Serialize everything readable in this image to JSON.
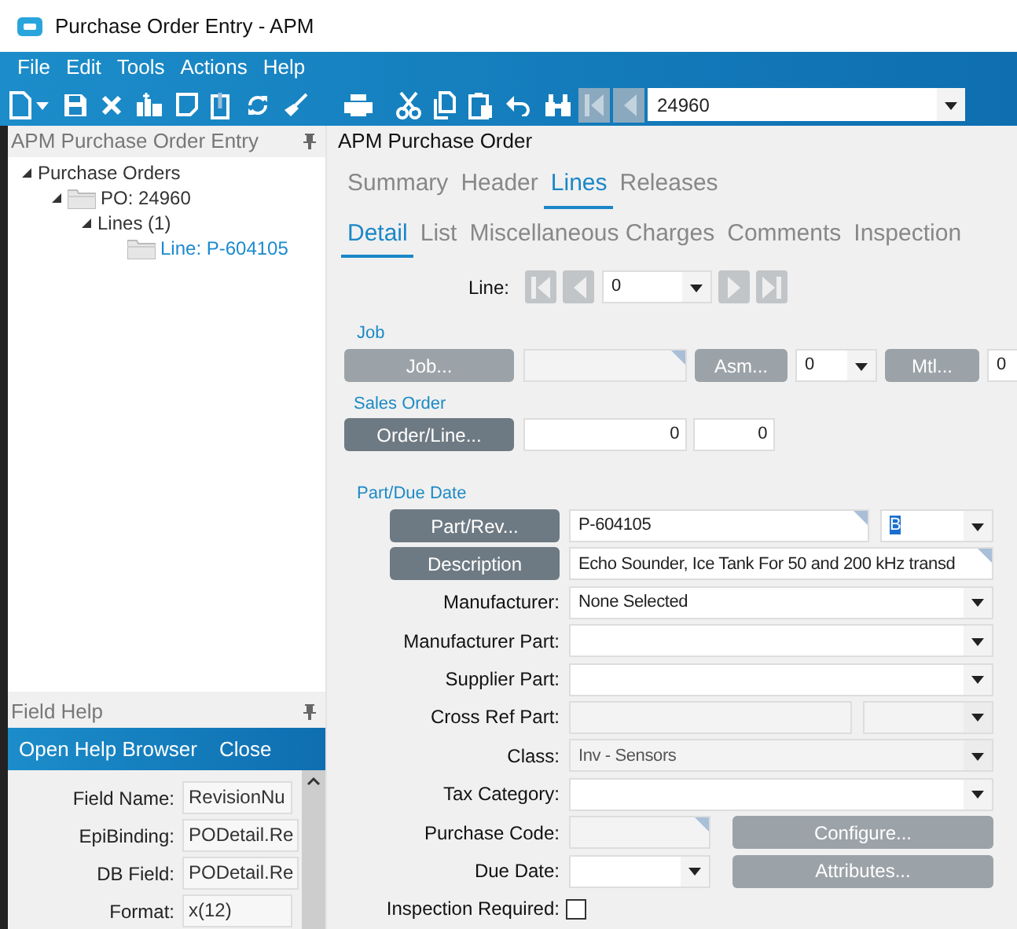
{
  "window": {
    "title": "Purchase Order Entry - APM"
  },
  "menu": [
    "File",
    "Edit",
    "Tools",
    "Actions",
    "Help"
  ],
  "toolbar": {
    "record": "24960"
  },
  "left_panel": {
    "title": "APM Purchase Order Entry",
    "tree": [
      {
        "label": "Purchase Orders",
        "kind": "group",
        "expanded": true,
        "selected": false,
        "children": [
          {
            "label": "PO: 24960",
            "kind": "folder",
            "expanded": true,
            "selected": false,
            "children": [
              {
                "label": "Lines (1)",
                "kind": "group",
                "expanded": true,
                "selected": false,
                "children": [
                  {
                    "label": "Line: P-604105",
                    "kind": "folder",
                    "selected": true
                  }
                ]
              }
            ]
          }
        ]
      }
    ]
  },
  "field_help": {
    "title": "Field Help",
    "actions": [
      "Open Help Browser",
      "Close"
    ],
    "fields": [
      {
        "label": "Field Name:",
        "value": "RevisionNu"
      },
      {
        "label": "EpiBinding:",
        "value": "PODetail.Re"
      },
      {
        "label": "DB Field:",
        "value": "PODetail.Re"
      },
      {
        "label": "Format:",
        "value": "x(12)"
      }
    ]
  },
  "main": {
    "title": "APM Purchase Order",
    "tabs": [
      {
        "label": "Summary",
        "selected": false
      },
      {
        "label": "Header",
        "selected": false
      },
      {
        "label": "Lines",
        "selected": true
      },
      {
        "label": "Releases",
        "selected": false
      }
    ],
    "subtabs": [
      {
        "label": "Detail",
        "selected": true
      },
      {
        "label": "List",
        "selected": false
      },
      {
        "label": "Miscellaneous Charges",
        "selected": false
      },
      {
        "label": "Comments",
        "selected": false
      },
      {
        "label": "Inspection",
        "selected": false
      }
    ],
    "line": {
      "label": "Line:",
      "value": "0"
    },
    "job": {
      "title": "Job",
      "job_button": {
        "label": "Job...",
        "disabled": true
      },
      "asm_button": {
        "label": "Asm...",
        "disabled": true
      },
      "asm_value": "0",
      "mtl_button": {
        "label": "Mtl...",
        "disabled": true
      },
      "mtl_value": "0"
    },
    "sales_order": {
      "title": "Sales Order",
      "button": {
        "label": "Order/Line...",
        "disabled": false
      },
      "order": "0",
      "line": "0"
    },
    "part": {
      "title": "Part/Due Date",
      "rows": [
        {
          "kind": "button",
          "label": "Part/Rev...",
          "fields": [
            {
              "kind": "text",
              "value": "P-604105",
              "disabled": false,
              "lookup": true
            },
            {
              "kind": "combo",
              "value": "B",
              "disabled": false,
              "lookup": false,
              "text_selected": true
            }
          ]
        },
        {
          "kind": "button",
          "label": "Description",
          "fields": [
            {
              "kind": "text",
              "value": "Echo Sounder, Ice Tank For 50 and 200 kHz transd",
              "disabled": false,
              "lookup": true
            }
          ]
        },
        {
          "kind": "label",
          "label": "Manufacturer:",
          "fields": [
            {
              "kind": "combo",
              "value": "None Selected",
              "disabled": false,
              "lookup": false
            }
          ]
        },
        {
          "kind": "label",
          "label": "Manufacturer Part:",
          "fields": [
            {
              "kind": "combo",
              "disabled": false,
              "lookup": false
            }
          ]
        },
        {
          "kind": "label",
          "label": "Supplier Part:",
          "fields": [
            {
              "kind": "combo",
              "disabled": false,
              "lookup": false
            }
          ]
        },
        {
          "kind": "label",
          "label": "Cross Ref Part:",
          "fields": [
            {
              "kind": "text",
              "disabled": true,
              "lookup": false
            },
            {
              "kind": "combo",
              "disabled": true,
              "lookup": false
            }
          ]
        },
        {
          "kind": "label",
          "label": "Class:",
          "fields": [
            {
              "kind": "combo",
              "value": "Inv - Sensors",
              "disabled": true,
              "lookup": false
            }
          ]
        },
        {
          "kind": "label",
          "label": "Tax Category:",
          "fields": [
            {
              "kind": "combo",
              "disabled": false,
              "lookup": false
            }
          ]
        },
        {
          "kind": "label",
          "label": "Purchase Code:",
          "fields": [
            {
              "kind": "text",
              "disabled": true,
              "lookup": true
            },
            {
              "kind": "button",
              "value": "Configure...",
              "disabled": true
            }
          ]
        },
        {
          "kind": "label",
          "label": "Due Date:",
          "fields": [
            {
              "kind": "date",
              "disabled": false,
              "lookup": false
            },
            {
              "kind": "button",
              "value": "Attributes...",
              "disabled": true
            }
          ]
        },
        {
          "kind": "checkbox",
          "label": "Inspection Required:",
          "checked": false
        }
      ]
    }
  }
}
